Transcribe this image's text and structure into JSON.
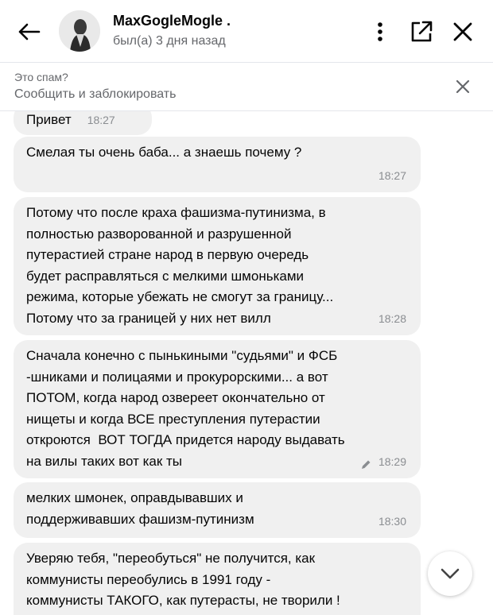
{
  "header": {
    "name": "MaxGogleMogle .",
    "status": "был(а) 3 дня назад"
  },
  "icons": {
    "back": "arrow-left-icon",
    "more": "vertical-dots-icon",
    "popout": "open-in-new-window-icon",
    "close": "close-icon",
    "scroll": "chevron-down-icon"
  },
  "spam": {
    "question": "Это спам?",
    "action": "Сообщить и заблокировать"
  },
  "messages": [
    {
      "text": "Привет",
      "time": "18:27"
    },
    {
      "text": "Смелая ты очень баба... а знаешь почему ?",
      "time": "18:27"
    },
    {
      "text": "Потому что после краха фашизма-путинизма, в\nполностью разворованной и разрушенной\nпутерастией стране народ в первую очередь\nбудет расправляться с мелкими шмоньками\nрежима, которые убежать не смогут за границу...\nПотому что за границей у них нет вилл",
      "time": "18:28"
    },
    {
      "text": "Сначала конечно с пынькиными \"судьями\" и ФСБ\n-шниками и полицаями и прокурорскими... а вот\nПОТОМ, когда народ озвереет окончательно от\nнищеты и когда ВСЕ преступления путерастии\nоткроются  ВОТ ТОГДА придется народу выдавать\nна вилы таких вот как ты",
      "time": "18:29",
      "edited": true
    },
    {
      "text": "мелких шмонек, оправдывавших и\nподдерживавших фашизм-путинизм",
      "time": "18:30"
    },
    {
      "text": "Уверяю тебя, \"переобуться\" не получится, как\nкоммунисты переобулись в 1991 году -\nкоммунисты ТАКОГО, как путерасты, не творили !",
      "time": ""
    }
  ]
}
